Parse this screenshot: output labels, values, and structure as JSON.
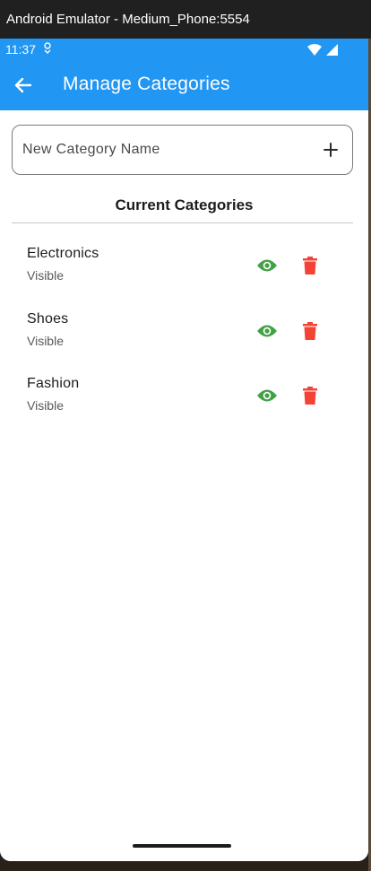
{
  "window": {
    "title": "Android Emulator - Medium_Phone:5554"
  },
  "status_bar": {
    "time": "11:37",
    "notification_icon": "sync-dot-icon",
    "icons": [
      "wifi-icon",
      "signal-icon"
    ]
  },
  "app_bar": {
    "title": "Manage Categories",
    "back_icon": "arrow-back-icon",
    "color": "#2196f3"
  },
  "new_category": {
    "placeholder": "New Category Name",
    "value": "",
    "add_icon": "plus-icon"
  },
  "section": {
    "title": "Current Categories"
  },
  "categories": [
    {
      "name": "Electronics",
      "status": "Visible"
    },
    {
      "name": "Shoes",
      "status": "Visible"
    },
    {
      "name": "Fashion",
      "status": "Visible"
    }
  ],
  "colors": {
    "accent": "#2196f3",
    "visible_icon": "#43a047",
    "delete_icon": "#f44336"
  }
}
